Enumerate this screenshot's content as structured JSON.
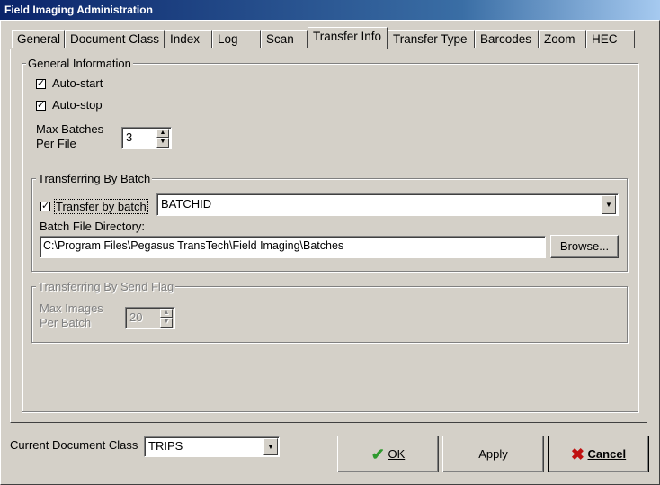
{
  "window": {
    "title": "Field Imaging Administration"
  },
  "tabs": [
    {
      "label": "General"
    },
    {
      "label": "Document Class"
    },
    {
      "label": "Index"
    },
    {
      "label": "Log"
    },
    {
      "label": "Scan"
    },
    {
      "label": "Transfer Info"
    },
    {
      "label": "Transfer Type"
    },
    {
      "label": "Barcodes"
    },
    {
      "label": "Zoom"
    },
    {
      "label": "HEC"
    }
  ],
  "active_tab": "Transfer Info",
  "general_info": {
    "legend": "General Information",
    "auto_start_label": "Auto-start",
    "auto_start_checked": true,
    "auto_stop_label": "Auto-stop",
    "auto_stop_checked": true,
    "max_batches_label_1": "Max Batches",
    "max_batches_label_2": "Per File",
    "max_batches_value": "3"
  },
  "by_batch": {
    "legend": "Transferring By Batch",
    "transfer_label": "Transfer by batch",
    "transfer_checked": true,
    "field_value": "BATCHID",
    "dir_label": "Batch File Directory:",
    "dir_value": "C:\\Program Files\\Pegasus TransTech\\Field Imaging\\Batches",
    "browse_label": "Browse..."
  },
  "by_send_flag": {
    "legend": "Transferring By Send Flag",
    "max_images_label_1": "Max Images",
    "max_images_label_2": "Per Batch",
    "max_images_value": "20"
  },
  "footer": {
    "doc_class_label": "Current Document Class",
    "doc_class_value": "TRIPS",
    "ok_label": "OK",
    "apply_label": "Apply",
    "cancel_label": "Cancel"
  },
  "colors": {
    "title_start": "#0a246a",
    "title_end": "#a6caf0",
    "ok_check": "#2e9a2e",
    "cancel_x": "#c01010"
  }
}
